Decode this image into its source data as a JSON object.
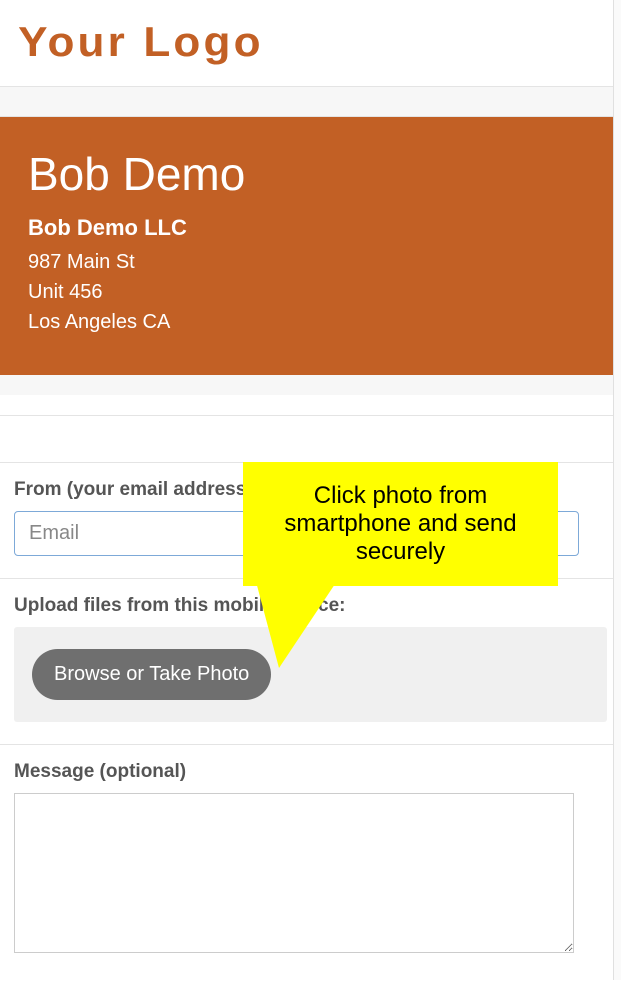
{
  "logo_text": "Your Logo",
  "profile": {
    "name": "Bob Demo",
    "company": "Bob Demo LLC",
    "address_line1": "987 Main St",
    "address_line2": "Unit 456",
    "city_state": "Los Angeles CA"
  },
  "form": {
    "from_label": "From (your email address)",
    "email_placeholder": "Email",
    "upload_label": "Upload files from this mobile device:",
    "browse_button": "Browse or Take Photo",
    "message_label": "Message (optional)"
  },
  "tooltip_text": "Click photo from smartphone and send securely"
}
